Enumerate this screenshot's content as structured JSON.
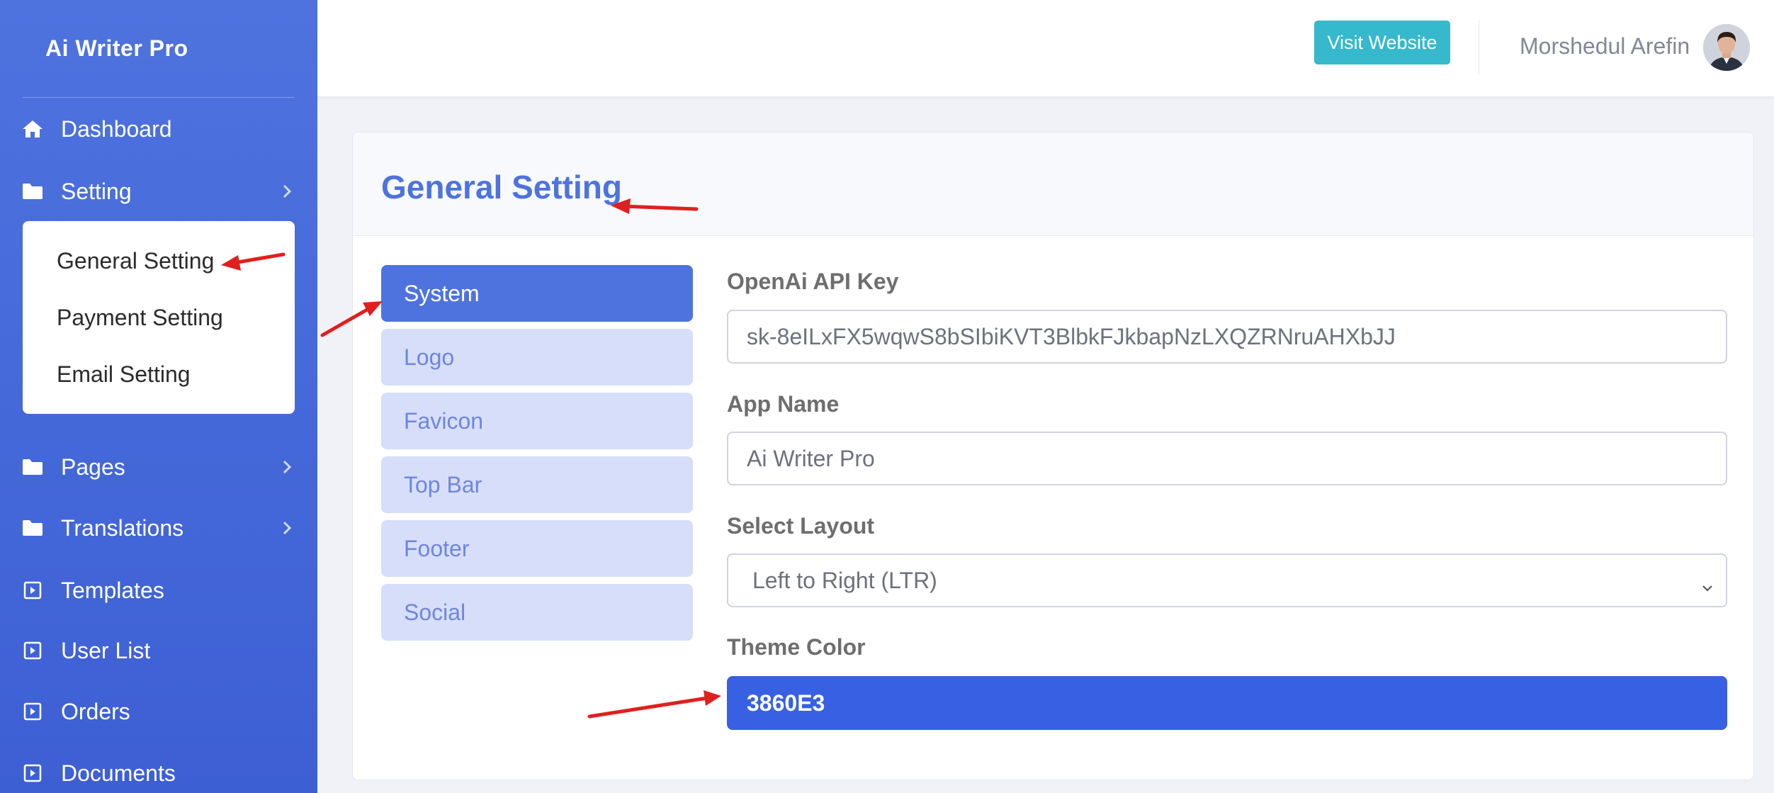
{
  "sidebar": {
    "brand": "Ai Writer Pro",
    "items": [
      {
        "label": "Dashboard"
      },
      {
        "label": "Setting"
      },
      {
        "label": "Pages"
      },
      {
        "label": "Translations"
      },
      {
        "label": "Templates"
      },
      {
        "label": "User List"
      },
      {
        "label": "Orders"
      },
      {
        "label": "Documents"
      }
    ],
    "setting_submenu": [
      {
        "label": "General Setting"
      },
      {
        "label": "Payment Setting"
      },
      {
        "label": "Email Setting"
      }
    ]
  },
  "topbar": {
    "visit_button": "Visit Website",
    "user_name": "Morshedul Arefin"
  },
  "card": {
    "title": "General Setting",
    "tabs": [
      {
        "label": "System",
        "active": true
      },
      {
        "label": "Logo"
      },
      {
        "label": "Favicon"
      },
      {
        "label": "Top Bar"
      },
      {
        "label": "Footer"
      },
      {
        "label": "Social"
      }
    ],
    "fields": {
      "api_key_label": "OpenAi API Key",
      "api_key_value": "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",
      "app_name_label": "App Name",
      "app_name_value": "Ai Writer Pro",
      "layout_label": "Select Layout",
      "layout_value": "Left to Right (LTR)",
      "theme_color_label": "Theme Color",
      "theme_color_value": "3860E3"
    }
  },
  "colors": {
    "primary": "#4e73df",
    "theme": "#3860E3",
    "visit_button": "#36b9cc",
    "annotation_arrow": "#e0201e"
  },
  "icons": [
    "home-icon",
    "folder-icon",
    "chevron-right-icon",
    "caret-square-icon",
    "chevron-down-icon"
  ]
}
